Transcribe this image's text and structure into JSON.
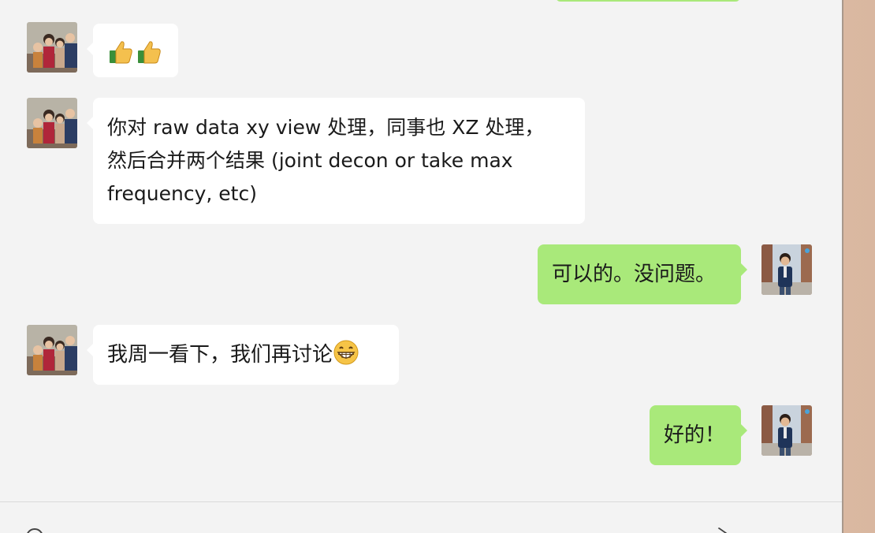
{
  "messages": [
    {
      "side": "left",
      "text": "",
      "emoji": [
        "thumbs-up",
        "thumbs-up"
      ]
    },
    {
      "side": "left",
      "text": "你对 raw data xy view 处理，同事也 XZ 处理，\n然后合并两个结果 (joint decon or take max\nfrequency, etc)"
    },
    {
      "side": "right",
      "text": "可以的。没问题。"
    },
    {
      "side": "left",
      "text": "我周一看下，我们再讨论",
      "emoji": [
        "grinning-face"
      ]
    },
    {
      "side": "right",
      "text": "好的！"
    }
  ],
  "colors": {
    "panel_bg": "#f3f3f3",
    "incoming_bubble": "#ffffff",
    "outgoing_bubble": "#a9e97a"
  },
  "icons": {
    "thumb": "thumbs-up-icon",
    "grin": "grinning-face-icon",
    "emoji_button": "smiley-icon",
    "send_tool": "scissors-icon"
  }
}
